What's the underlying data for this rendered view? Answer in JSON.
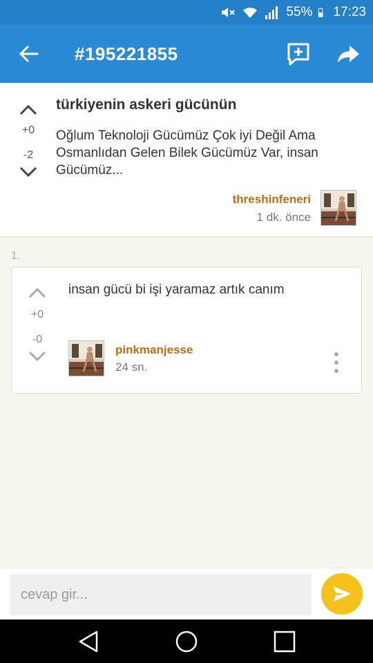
{
  "status_bar": {
    "battery_percent": "55%",
    "time": "17:23",
    "icons": [
      "mute-icon",
      "wifi-icon",
      "signal-icon",
      "battery-icon"
    ]
  },
  "app_bar": {
    "title": "#195221855",
    "icons": [
      "back-arrow-icon",
      "add-comment-icon",
      "share-icon"
    ],
    "color": "#2b8ad6"
  },
  "post": {
    "title": "türkiyenin askeri gücünün",
    "body": "Oğlum Teknoloji Gücümüz Çok iyi Değil Ama Osmanlıdan Gelen Bilek Gücümüz Var, insan Gücümüz...",
    "upvotes": "+0",
    "downvotes": "-2",
    "author": "threshinfeneri",
    "time": "1 dk. önce"
  },
  "comments": [
    {
      "index": "1.",
      "text": "insan gücü bi işi yaramaz artık canım",
      "upvotes": "+0",
      "downvotes": "-0",
      "author": "pinkmanjesse",
      "time": "24 sn."
    }
  ],
  "reply": {
    "placeholder": "cevap gir...",
    "send_color": "#f4c21a"
  },
  "colors": {
    "author": "#c36a12",
    "background": "#f7f6ee"
  }
}
